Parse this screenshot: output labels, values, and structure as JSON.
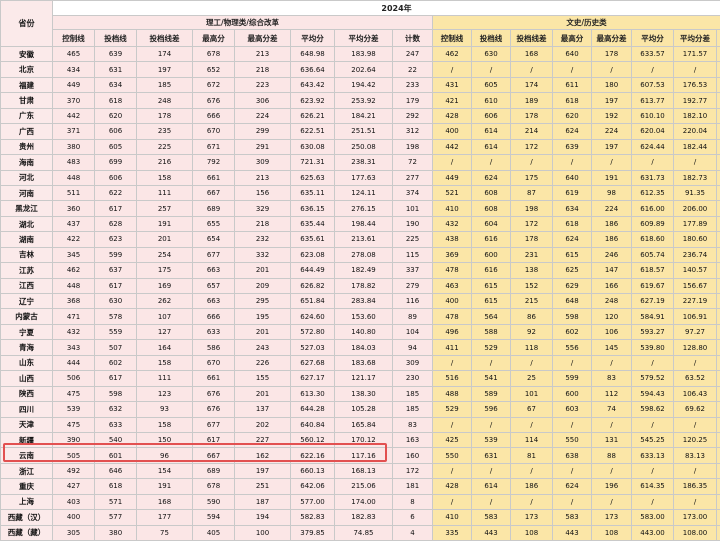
{
  "year_title": "2024年",
  "province_header": "省份",
  "group_left": "理工/物理类/综合改革",
  "group_right": "文史/历史类",
  "columns_left": [
    "控制线",
    "投档线",
    "投档线差",
    "最高分",
    "最高分差",
    "平均分",
    "平均分差",
    "计数"
  ],
  "columns_right": [
    "控制线",
    "投档线",
    "投档线差",
    "最高分",
    "最高分差",
    "平均分",
    "平均分差",
    "计数"
  ],
  "highlighted_row": "浙江",
  "colors": {
    "pink": "#fbe6e6",
    "yellow": "#fbe6a7",
    "highlight": "#e25050"
  },
  "rows": [
    {
      "province": "安徽",
      "left": [
        "465",
        "639",
        "174",
        "678",
        "213",
        "648.98",
        "183.98",
        "247"
      ],
      "right": [
        "462",
        "630",
        "168",
        "640",
        "178",
        "633.57",
        "171.57",
        "23"
      ]
    },
    {
      "province": "北京",
      "left": [
        "434",
        "631",
        "197",
        "652",
        "218",
        "636.64",
        "202.64",
        "22"
      ],
      "right": [
        "/",
        "/",
        "/",
        "/",
        "/",
        "/",
        "/",
        "/"
      ]
    },
    {
      "province": "福建",
      "left": [
        "449",
        "634",
        "185",
        "672",
        "223",
        "643.42",
        "194.42",
        "233"
      ],
      "right": [
        "431",
        "605",
        "174",
        "611",
        "180",
        "607.53",
        "176.53",
        "17"
      ]
    },
    {
      "province": "甘肃",
      "left": [
        "370",
        "618",
        "248",
        "676",
        "306",
        "623.92",
        "253.92",
        "179"
      ],
      "right": [
        "421",
        "610",
        "189",
        "618",
        "197",
        "613.77",
        "192.77",
        "13"
      ]
    },
    {
      "province": "广东",
      "left": [
        "442",
        "620",
        "178",
        "666",
        "224",
        "626.21",
        "184.21",
        "292"
      ],
      "right": [
        "428",
        "606",
        "178",
        "620",
        "192",
        "610.10",
        "182.10",
        "31"
      ]
    },
    {
      "province": "广西",
      "left": [
        "371",
        "606",
        "235",
        "670",
        "299",
        "622.51",
        "251.51",
        "312"
      ],
      "right": [
        "400",
        "614",
        "214",
        "624",
        "224",
        "620.04",
        "220.04",
        "23"
      ]
    },
    {
      "province": "贵州",
      "left": [
        "380",
        "605",
        "225",
        "671",
        "291",
        "630.08",
        "250.08",
        "198"
      ],
      "right": [
        "442",
        "614",
        "172",
        "639",
        "197",
        "624.44",
        "182.44",
        "18"
      ]
    },
    {
      "province": "海南",
      "left": [
        "483",
        "699",
        "216",
        "792",
        "309",
        "721.31",
        "238.31",
        "72"
      ],
      "right": [
        "/",
        "/",
        "/",
        "/",
        "/",
        "/",
        "/",
        "/"
      ]
    },
    {
      "province": "河北",
      "left": [
        "448",
        "606",
        "158",
        "661",
        "213",
        "625.63",
        "177.63",
        "277"
      ],
      "right": [
        "449",
        "624",
        "175",
        "640",
        "191",
        "631.73",
        "182.73",
        "30"
      ]
    },
    {
      "province": "河南",
      "left": [
        "511",
        "622",
        "111",
        "667",
        "156",
        "635.11",
        "124.11",
        "374"
      ],
      "right": [
        "521",
        "608",
        "87",
        "619",
        "98",
        "612.35",
        "91.35",
        "23"
      ]
    },
    {
      "province": "黑龙江",
      "left": [
        "360",
        "617",
        "257",
        "689",
        "329",
        "636.15",
        "276.15",
        "101"
      ],
      "right": [
        "410",
        "608",
        "198",
        "634",
        "224",
        "616.00",
        "206.00",
        "22"
      ]
    },
    {
      "province": "湖北",
      "left": [
        "437",
        "628",
        "191",
        "655",
        "218",
        "635.44",
        "198.44",
        "190"
      ],
      "right": [
        "432",
        "604",
        "172",
        "618",
        "186",
        "609.89",
        "177.89",
        "19"
      ]
    },
    {
      "province": "湖南",
      "left": [
        "422",
        "623",
        "201",
        "654",
        "232",
        "635.61",
        "213.61",
        "225"
      ],
      "right": [
        "438",
        "616",
        "178",
        "624",
        "186",
        "618.60",
        "180.60",
        "35"
      ]
    },
    {
      "province": "吉林",
      "left": [
        "345",
        "599",
        "254",
        "677",
        "332",
        "623.08",
        "278.08",
        "115"
      ],
      "right": [
        "369",
        "600",
        "231",
        "615",
        "246",
        "605.74",
        "236.74",
        "19"
      ]
    },
    {
      "province": "江苏",
      "left": [
        "462",
        "637",
        "175",
        "663",
        "201",
        "644.49",
        "182.49",
        "337"
      ],
      "right": [
        "478",
        "616",
        "138",
        "625",
        "147",
        "618.57",
        "140.57",
        "23"
      ]
    },
    {
      "province": "江西",
      "left": [
        "448",
        "617",
        "169",
        "657",
        "209",
        "626.82",
        "178.82",
        "279"
      ],
      "right": [
        "463",
        "615",
        "152",
        "629",
        "166",
        "619.67",
        "156.67",
        "24"
      ]
    },
    {
      "province": "辽宁",
      "left": [
        "368",
        "630",
        "262",
        "663",
        "295",
        "651.84",
        "283.84",
        "116"
      ],
      "right": [
        "400",
        "615",
        "215",
        "648",
        "248",
        "627.19",
        "227.19",
        "16"
      ]
    },
    {
      "province": "内蒙古",
      "left": [
        "471",
        "578",
        "107",
        "666",
        "195",
        "624.60",
        "153.60",
        "89"
      ],
      "right": [
        "478",
        "564",
        "86",
        "598",
        "120",
        "584.91",
        "106.91",
        "23"
      ]
    },
    {
      "province": "宁夏",
      "left": [
        "432",
        "559",
        "127",
        "633",
        "201",
        "572.80",
        "140.80",
        "104"
      ],
      "right": [
        "496",
        "588",
        "92",
        "602",
        "106",
        "593.27",
        "97.27",
        "11"
      ]
    },
    {
      "province": "青海",
      "left": [
        "343",
        "507",
        "164",
        "586",
        "243",
        "527.03",
        "184.03",
        "94"
      ],
      "right": [
        "411",
        "529",
        "118",
        "556",
        "145",
        "539.80",
        "128.80",
        "10"
      ]
    },
    {
      "province": "山东",
      "left": [
        "444",
        "602",
        "158",
        "670",
        "226",
        "627.68",
        "183.68",
        "309"
      ],
      "right": [
        "/",
        "/",
        "/",
        "/",
        "/",
        "/",
        "/",
        "/"
      ]
    },
    {
      "province": "山西",
      "left": [
        "506",
        "617",
        "111",
        "661",
        "155",
        "627.17",
        "121.17",
        "230"
      ],
      "right": [
        "516",
        "541",
        "25",
        "599",
        "83",
        "579.52",
        "63.52",
        "29"
      ]
    },
    {
      "province": "陕西",
      "left": [
        "475",
        "598",
        "123",
        "676",
        "201",
        "613.30",
        "138.30",
        "185"
      ],
      "right": [
        "488",
        "589",
        "101",
        "600",
        "112",
        "594.43",
        "106.43",
        "14"
      ]
    },
    {
      "province": "四川",
      "left": [
        "539",
        "632",
        "93",
        "676",
        "137",
        "644.28",
        "105.28",
        "185"
      ],
      "right": [
        "529",
        "596",
        "67",
        "603",
        "74",
        "598.62",
        "69.62",
        "21"
      ]
    },
    {
      "province": "天津",
      "left": [
        "475",
        "633",
        "158",
        "677",
        "202",
        "640.84",
        "165.84",
        "83"
      ],
      "right": [
        "/",
        "/",
        "/",
        "/",
        "/",
        "/",
        "/",
        "/"
      ]
    },
    {
      "province": "新疆",
      "left": [
        "390",
        "540",
        "150",
        "617",
        "227",
        "560.12",
        "170.12",
        "163"
      ],
      "right": [
        "425",
        "539",
        "114",
        "550",
        "131",
        "545.25",
        "120.25",
        "12"
      ]
    },
    {
      "province": "云南",
      "left": [
        "505",
        "601",
        "96",
        "667",
        "162",
        "622.16",
        "117.16",
        "160"
      ],
      "right": [
        "550",
        "631",
        "81",
        "638",
        "88",
        "633.13",
        "83.13",
        "15"
      ]
    },
    {
      "province": "浙江",
      "left": [
        "492",
        "646",
        "154",
        "689",
        "197",
        "660.13",
        "168.13",
        "172"
      ],
      "right": [
        "/",
        "/",
        "/",
        "/",
        "/",
        "/",
        "/",
        "/"
      ]
    },
    {
      "province": "重庆",
      "left": [
        "427",
        "618",
        "191",
        "678",
        "251",
        "642.06",
        "215.06",
        "181"
      ],
      "right": [
        "428",
        "614",
        "186",
        "624",
        "196",
        "614.35",
        "186.35",
        "17"
      ]
    },
    {
      "province": "上海",
      "left": [
        "403",
        "571",
        "168",
        "590",
        "187",
        "577.00",
        "174.00",
        "8"
      ],
      "right": [
        "/",
        "/",
        "/",
        "/",
        "/",
        "/",
        "/",
        "/"
      ]
    },
    {
      "province": "西藏（汉）",
      "left": [
        "400",
        "577",
        "177",
        "594",
        "194",
        "582.83",
        "182.83",
        "6"
      ],
      "right": [
        "410",
        "583",
        "173",
        "583",
        "173",
        "583.00",
        "173.00",
        "1"
      ]
    },
    {
      "province": "西藏（藏）",
      "left": [
        "305",
        "380",
        "75",
        "405",
        "100",
        "379.85",
        "74.85",
        "4"
      ],
      "right": [
        "335",
        "443",
        "108",
        "443",
        "108",
        "443.00",
        "108.00",
        "1"
      ]
    }
  ]
}
